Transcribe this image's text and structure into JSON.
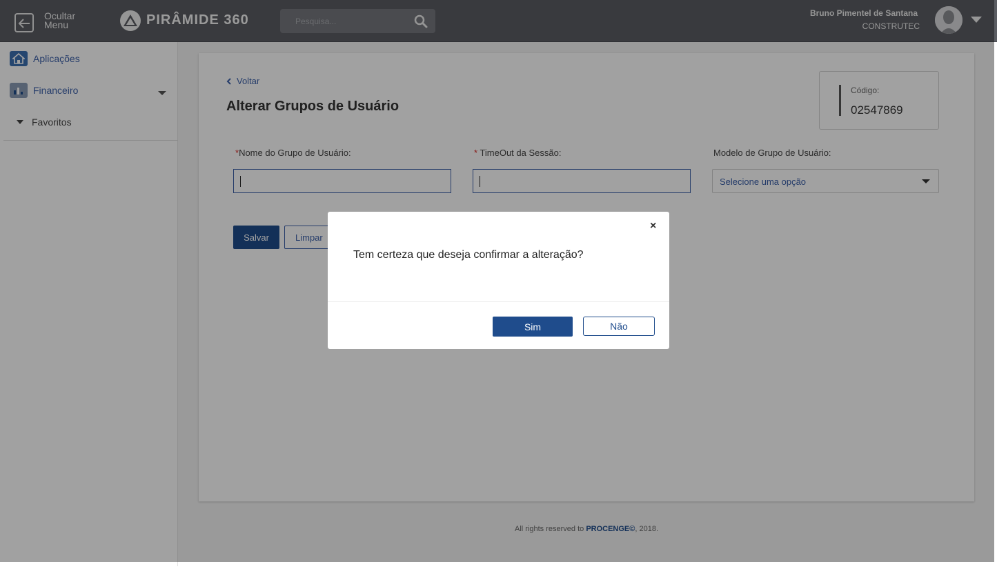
{
  "topbar": {
    "menu_label": "Ocultar Menu",
    "brand": "PIRÂMIDE 360",
    "search_placeholder": "Pesquisa...",
    "user_name": "Bruno Pimentel de Santana",
    "user_org": "CONSTRUTEC"
  },
  "sidebar": {
    "items": [
      {
        "label": "Aplicações",
        "icon": "home-icon"
      },
      {
        "label": "Financeiro",
        "icon": "finance-icon"
      },
      {
        "label": "Favoritos",
        "icon": "caret-down-icon"
      }
    ]
  },
  "page": {
    "back_label": "Voltar",
    "title": "Alterar Grupos de Usuário",
    "code_label": "Código:",
    "code_value": "02547869"
  },
  "form": {
    "group_name_label": "Nome do Grupo de Usuário:",
    "group_name_value": "",
    "timeout_label": " TimeOut da Sessão:",
    "timeout_value": "",
    "model_label": "Modelo de Grupo de Usuário:",
    "model_selected": "Selecione uma opção",
    "required_marker": "*",
    "save_label": "Salvar",
    "clear_label": "Limpar"
  },
  "footer": {
    "prefix": "All rights reserved to ",
    "company": "PROCENGE©",
    "suffix": ", 2018."
  },
  "modal": {
    "close_symbol": "×",
    "message": "Tem certeza que deseja confirmar a alteração?",
    "yes_label": "Sim",
    "no_label": "Não"
  },
  "colors": {
    "topbar": "#5b5d63",
    "primary": "#1f4c8c",
    "link": "#3b5fa8",
    "required": "#d9302c"
  }
}
